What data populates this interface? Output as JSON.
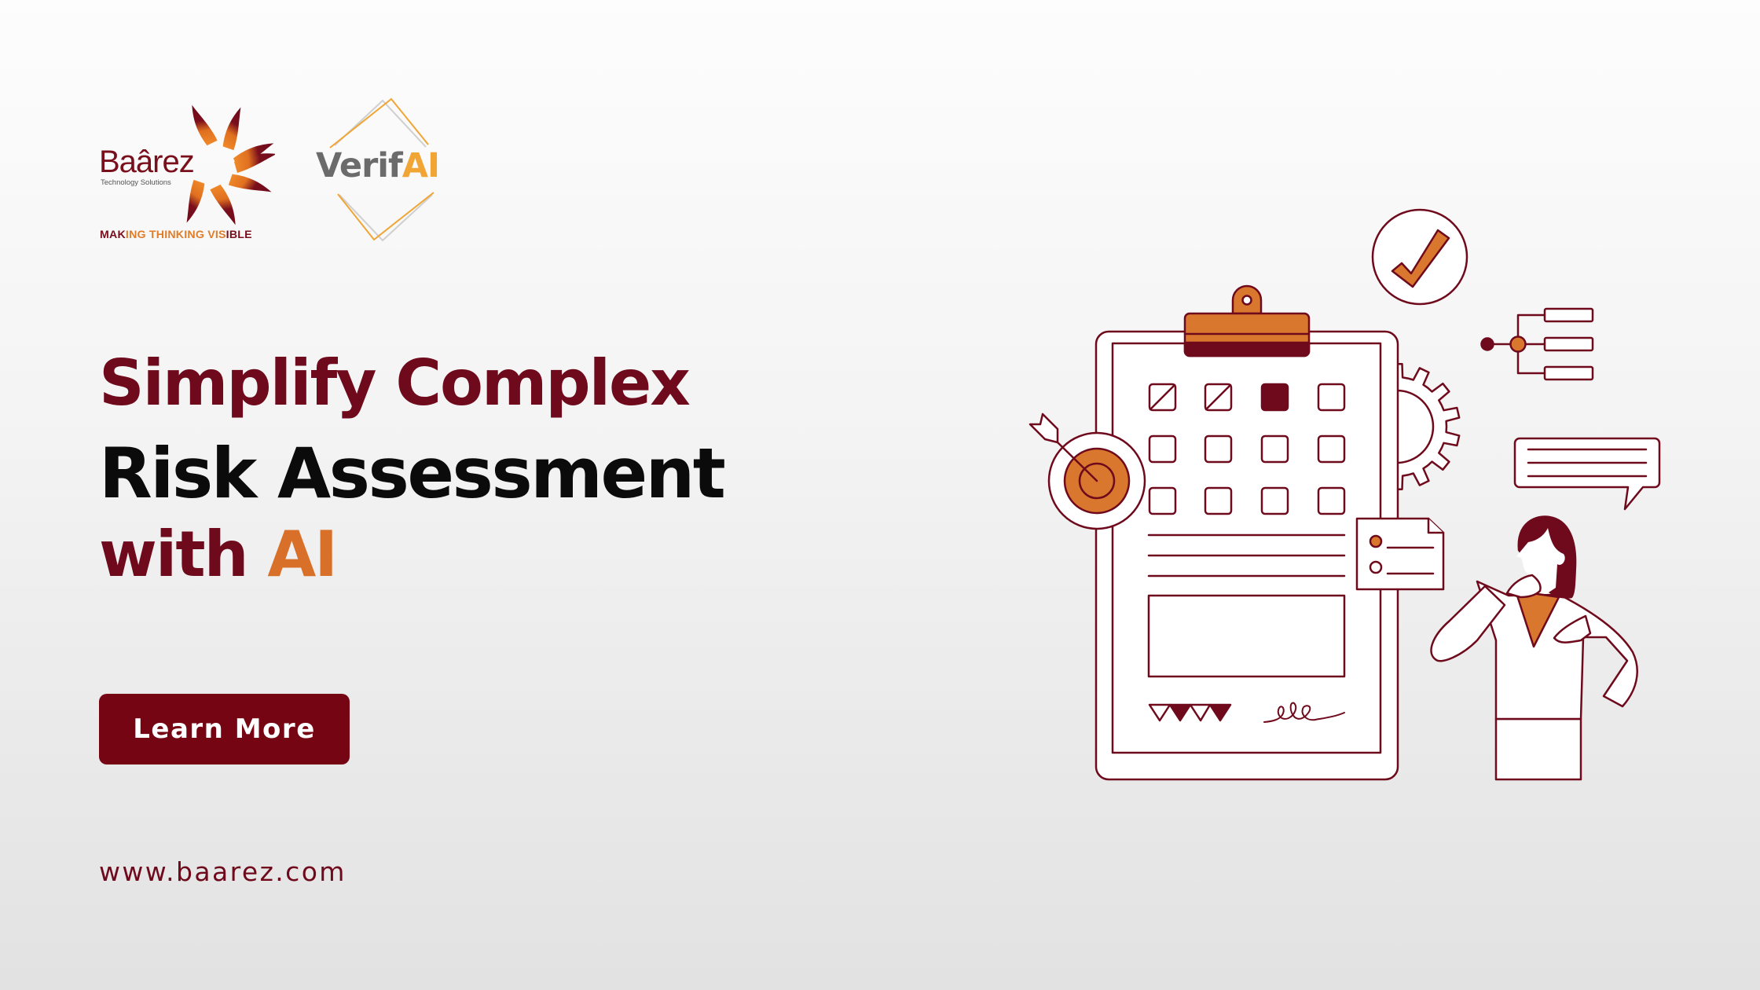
{
  "brand": {
    "baarez": {
      "name": "Baârez",
      "subtitle": "Technology Solutions",
      "tagline_parts": [
        "MAK",
        "ING THINKING VIS",
        "IBLE"
      ]
    },
    "verifai": {
      "name_part1": "Verif",
      "name_part2": "AI"
    }
  },
  "headline": {
    "line1": "Simplify Complex",
    "line2": "Risk Assessment",
    "line3_prefix": "with ",
    "line3_accent": "AI"
  },
  "cta": {
    "label": "Learn More"
  },
  "footer": {
    "website": "www.baarez.com"
  },
  "illustration": {
    "checklist_states": [
      [
        "slashed",
        "slashed",
        "filled",
        "empty"
      ],
      [
        "empty",
        "empty",
        "empty",
        "empty"
      ],
      [
        "empty",
        "empty",
        "empty",
        "empty"
      ]
    ],
    "note_card_items": [
      "filled",
      "empty"
    ],
    "icons": [
      "clipboard-icon",
      "checkmark-icon",
      "gear-icon",
      "target-icon",
      "tree-diagram-icon",
      "speech-bubble-icon",
      "note-card-icon",
      "person-icon"
    ]
  },
  "colors": {
    "maroon": "#6e0a1c",
    "button": "#760514",
    "orange": "#d9702a",
    "verifai_orange": "#f0a535",
    "gray": "#6b6b6b"
  }
}
